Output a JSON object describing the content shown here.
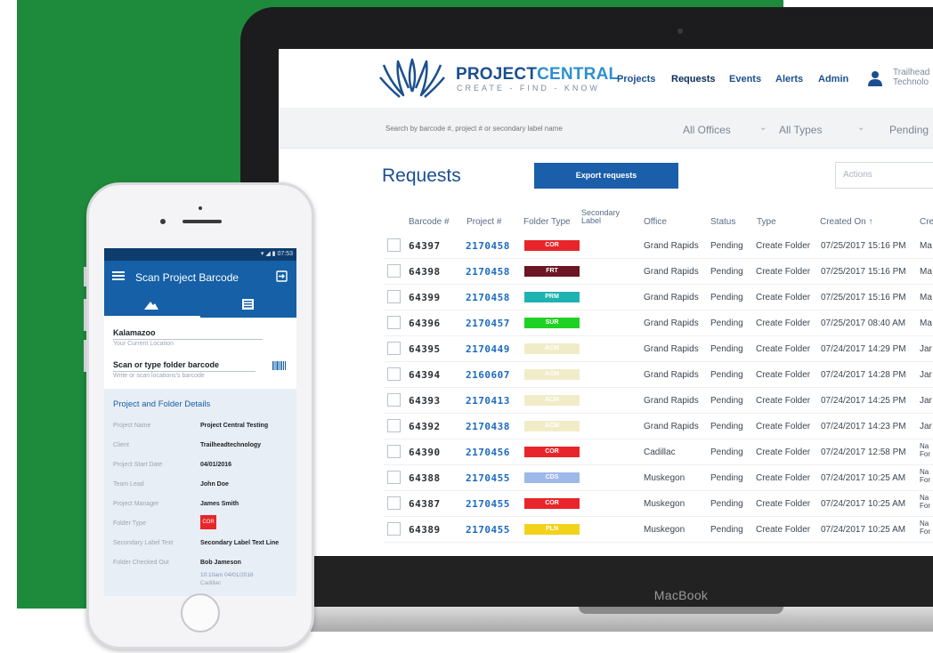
{
  "colors": {
    "background_green": "#1e8b3c",
    "brand_blue": "#1b4f8f",
    "link_blue": "#1b6ac0",
    "button_blue": "#1b5faa",
    "phone_bar": "#1560a6"
  },
  "web": {
    "logo": {
      "title_main": "PROJECT",
      "title_accent": "CENTRAL",
      "tagline": "CREATE - FIND - KNOW"
    },
    "nav": [
      "Projects",
      "Requests",
      "Events",
      "Alerts",
      "Admin"
    ],
    "user": {
      "line1": "Trailhead",
      "line2": "Technolo"
    },
    "search": {
      "placeholder": "Search by barcode #, project # or secondary label name",
      "filters": [
        "All Offices",
        "All Types",
        "Pending"
      ]
    },
    "page_title": "Requests",
    "export_label": "Export requests",
    "actions_placeholder": "Actions",
    "columns": {
      "barcode": "Barcode #",
      "project": "Project #",
      "folder_type": "Folder Type",
      "secondary_1": "Secondary",
      "secondary_2": "Label",
      "office": "Office",
      "status": "Status",
      "type": "Type",
      "created_on": "Created On ↑",
      "created_by": "Cre"
    },
    "rows": [
      {
        "barcode": "64397",
        "project": "2170458",
        "folder": "COR",
        "folder_color": "#e8252b",
        "office": "Grand Rapids",
        "status": "Pending",
        "type": "Create Folder",
        "created": "07/25/2017 15:16 PM",
        "by": "Ma"
      },
      {
        "barcode": "64398",
        "project": "2170458",
        "folder": "FRT",
        "folder_color": "#6b1622",
        "office": "Grand Rapids",
        "status": "Pending",
        "type": "Create Folder",
        "created": "07/25/2017 15:16 PM",
        "by": "Ma"
      },
      {
        "barcode": "64399",
        "project": "2170458",
        "folder": "PRM",
        "folder_color": "#1eb3b0",
        "office": "Grand Rapids",
        "status": "Pending",
        "type": "Create Folder",
        "created": "07/25/2017 15:16 PM",
        "by": "Ma"
      },
      {
        "barcode": "64396",
        "project": "2170457",
        "folder": "SUR",
        "folder_color": "#1fd123",
        "office": "Grand Rapids",
        "status": "Pending",
        "type": "Create Folder",
        "created": "07/25/2017 08:40 AM",
        "by": "Ma"
      },
      {
        "barcode": "64395",
        "project": "2170449",
        "folder": "ACM",
        "folder_color": "#f1ecc8",
        "office": "Grand Rapids",
        "status": "Pending",
        "type": "Create Folder",
        "created": "07/24/2017 14:29 PM",
        "by": "Jar"
      },
      {
        "barcode": "64394",
        "project": "2160607",
        "folder": "ACM",
        "folder_color": "#f1ecc8",
        "office": "Grand Rapids",
        "status": "Pending",
        "type": "Create Folder",
        "created": "07/24/2017 14:28 PM",
        "by": "Jar"
      },
      {
        "barcode": "64393",
        "project": "2170413",
        "folder": "ACM",
        "folder_color": "#f1ecc8",
        "office": "Grand Rapids",
        "status": "Pending",
        "type": "Create Folder",
        "created": "07/24/2017 14:25 PM",
        "by": "Jar"
      },
      {
        "barcode": "64392",
        "project": "2170438",
        "folder": "ACM",
        "folder_color": "#f1ecc8",
        "office": "Grand Rapids",
        "status": "Pending",
        "type": "Create Folder",
        "created": "07/24/2017 14:23 PM",
        "by": "Jar"
      },
      {
        "barcode": "64390",
        "project": "2170456",
        "folder": "COR",
        "folder_color": "#e8252b",
        "office": "Cadillac",
        "status": "Pending",
        "type": "Create Folder",
        "created": "07/24/2017 12:58 PM",
        "by": "Na\nFor"
      },
      {
        "barcode": "64388",
        "project": "2170455",
        "folder": "CDS",
        "folder_color": "#9fb8ea",
        "office": "Muskegon",
        "status": "Pending",
        "type": "Create Folder",
        "created": "07/24/2017 10:25 AM",
        "by": "Na\nFor"
      },
      {
        "barcode": "64387",
        "project": "2170455",
        "folder": "COR",
        "folder_color": "#e8252b",
        "office": "Muskegon",
        "status": "Pending",
        "type": "Create Folder",
        "created": "07/24/2017 10:25 AM",
        "by": "Na\nFor"
      },
      {
        "barcode": "64389",
        "project": "2170455",
        "folder": "PLN",
        "folder_color": "#f2d21a",
        "office": "Muskegon",
        "status": "Pending",
        "type": "Create Folder",
        "created": "07/24/2017 10:25 AM",
        "by": "Na\nFor"
      }
    ]
  },
  "macbook_label": "MacBook",
  "phone": {
    "status_time": "▾ ◢ ▮ 07:53",
    "title": "Scan Project Barcode",
    "location_value": "Kalamazoo",
    "location_label": "Your Current Location",
    "scan_value": "Scan or type folder barcode",
    "scan_hint": "Write or scan locations's barcode",
    "details_title": "Project and Folder Details",
    "details": [
      {
        "label": "Project Name",
        "value": "Project Central Testing"
      },
      {
        "label": "Client",
        "value": "Trailheadtechnology"
      },
      {
        "label": "Project Start Date",
        "value": "04/01/2016"
      },
      {
        "label": "Team Lead",
        "value": "John Doe"
      },
      {
        "label": "Project Manager",
        "value": "James Smith"
      },
      {
        "label": "Folder Type",
        "value": "COR"
      },
      {
        "label": "Secondary Label Text",
        "value": "Secondary Label Text Line"
      },
      {
        "label": "Folder Checked Out",
        "value": "Bob Jameson"
      }
    ],
    "checkout_sub1": "10:10am 04/01/2016",
    "checkout_sub2": "Cadillac"
  }
}
